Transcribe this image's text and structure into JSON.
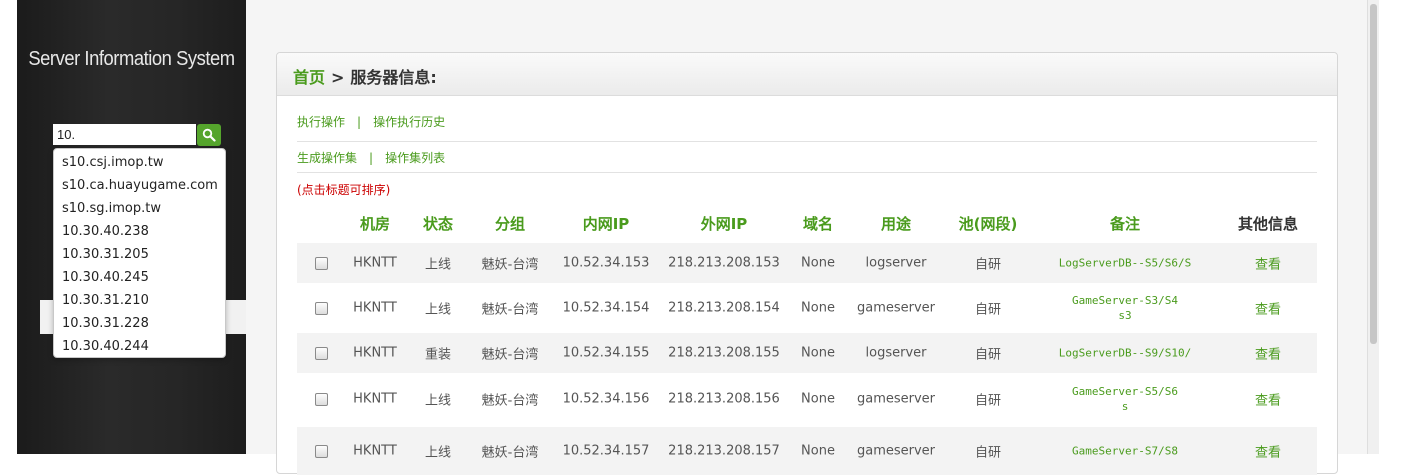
{
  "sidebar": {
    "title": "Server Information System",
    "search_value": "10.",
    "autocomplete": [
      "s10.csj.imop.tw",
      "s10.ca.huayugame.com",
      "s10.sg.imop.tw",
      "10.30.40.238",
      "10.30.31.205",
      "10.30.40.245",
      "10.30.31.210",
      "10.30.31.228",
      "10.30.40.244"
    ]
  },
  "breadcrumb": {
    "home": "首页",
    "separator": ">",
    "current": "服务器信息:"
  },
  "actions": {
    "execute": "执行操作",
    "history": "操作执行历史",
    "generate_set": "生成操作集",
    "set_list": "操作集列表",
    "separator": "|"
  },
  "sort_hint": "(点击标题可排序)",
  "table": {
    "headers": [
      "机房",
      "状态",
      "分组",
      "内网IP",
      "外网IP",
      "域名",
      "用途",
      "池(网段)",
      "备注",
      "其他信息"
    ],
    "rows": [
      {
        "idc": "HKNTT",
        "status": "上线",
        "group": "魅妖-台湾",
        "internal_ip": "10.52.34.153",
        "external_ip": "218.213.208.153",
        "domain": "None",
        "usage": "logserver",
        "pool": "自研",
        "remark_1": "LogServerDB--S5/S6/S",
        "remark_2": "",
        "view": "查看"
      },
      {
        "idc": "HKNTT",
        "status": "上线",
        "group": "魅妖-台湾",
        "internal_ip": "10.52.34.154",
        "external_ip": "218.213.208.154",
        "domain": "None",
        "usage": "gameserver",
        "pool": "自研",
        "remark_1": "GameServer-S3/S4",
        "remark_2": "s3",
        "view": "查看"
      },
      {
        "idc": "HKNTT",
        "status": "重装",
        "group": "魅妖-台湾",
        "internal_ip": "10.52.34.155",
        "external_ip": "218.213.208.155",
        "domain": "None",
        "usage": "logserver",
        "pool": "自研",
        "remark_1": "LogServerDB--S9/S10/",
        "remark_2": "",
        "view": "查看"
      },
      {
        "idc": "HKNTT",
        "status": "上线",
        "group": "魅妖-台湾",
        "internal_ip": "10.52.34.156",
        "external_ip": "218.213.208.156",
        "domain": "None",
        "usage": "gameserver",
        "pool": "自研",
        "remark_1": "GameServer-S5/S6",
        "remark_2": "s",
        "view": "查看"
      },
      {
        "idc": "HKNTT",
        "status": "上线",
        "group": "魅妖-台湾",
        "internal_ip": "10.52.34.157",
        "external_ip": "218.213.208.157",
        "domain": "None",
        "usage": "gameserver",
        "pool": "自研",
        "remark_1": "GameServer-S7/S8",
        "remark_2": "",
        "view": "查看"
      }
    ]
  },
  "colors": {
    "accent_green": "#4a9b1d",
    "search_button": "#55a52c",
    "hint_red": "#cc0000",
    "sidebar_bg": "#262626"
  },
  "icons": {
    "search": "search-icon"
  }
}
